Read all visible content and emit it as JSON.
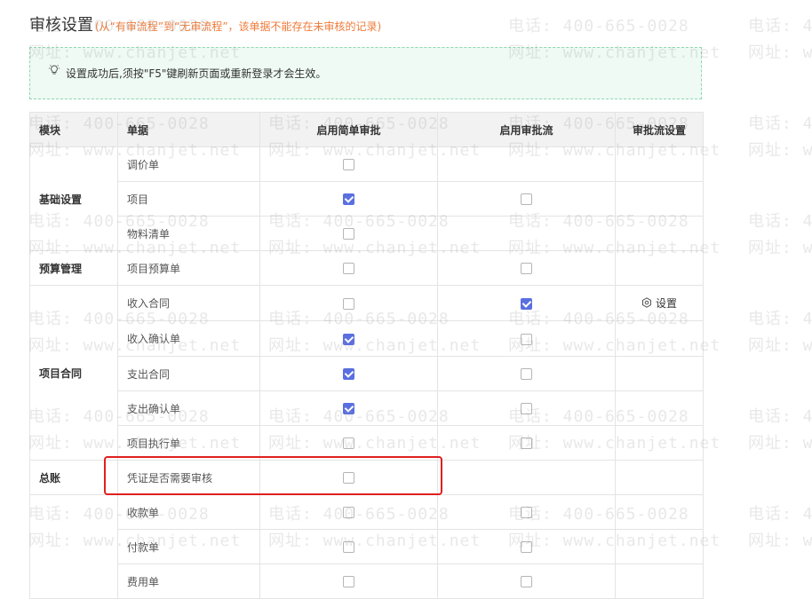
{
  "header": {
    "title": "审核设置",
    "subtitle": "(从“有审流程”到“无审流程”，该单据不能存在未审核的记录)"
  },
  "notice": {
    "icon": "lightbulb-icon",
    "text": "设置成功后,须按\"F5\"键刷新页面或重新登录才会生效。"
  },
  "watermark": {
    "phone": "电话: 400-665-0028",
    "site": "网址: www.chanjet.net"
  },
  "table": {
    "headers": {
      "module": "模块",
      "doc": "单据",
      "simple": "启用简单审批",
      "flow": "启用审批流",
      "flow_setting": "审批流设置"
    },
    "modules": [
      "基础设置",
      "预算管理",
      "项目合同",
      "总账"
    ],
    "rows": [
      {
        "doc": "调价单",
        "simple": false,
        "flow": null,
        "setting": ""
      },
      {
        "doc": "项目",
        "simple": true,
        "flow": false,
        "setting": ""
      },
      {
        "doc": "物料清单",
        "simple": false,
        "flow": null,
        "setting": ""
      },
      {
        "doc": "项目预算单",
        "simple": false,
        "flow": false,
        "setting": ""
      },
      {
        "doc": "收入合同",
        "simple": false,
        "flow": true,
        "setting": "设置"
      },
      {
        "doc": "收入确认单",
        "simple": true,
        "flow": false,
        "setting": ""
      },
      {
        "doc": "支出合同",
        "simple": true,
        "flow": false,
        "setting": ""
      },
      {
        "doc": "支出确认单",
        "simple": true,
        "flow": false,
        "setting": ""
      },
      {
        "doc": "项目执行单",
        "simple": false,
        "flow": false,
        "setting": ""
      },
      {
        "doc": "凭证是否需要审核",
        "simple": false,
        "flow": null,
        "setting": ""
      },
      {
        "doc": "收款单",
        "simple": false,
        "flow": false,
        "setting": ""
      },
      {
        "doc": "付款单",
        "simple": false,
        "flow": false,
        "setting": ""
      },
      {
        "doc": "费用单",
        "simple": false,
        "flow": false,
        "setting": ""
      }
    ]
  },
  "colors": {
    "accent": "#5a6fe0",
    "warning_text": "#ef7b3a",
    "highlight_box": "#e02020",
    "notice_border": "#8fd6b0",
    "notice_bg": "#eefaf3"
  }
}
